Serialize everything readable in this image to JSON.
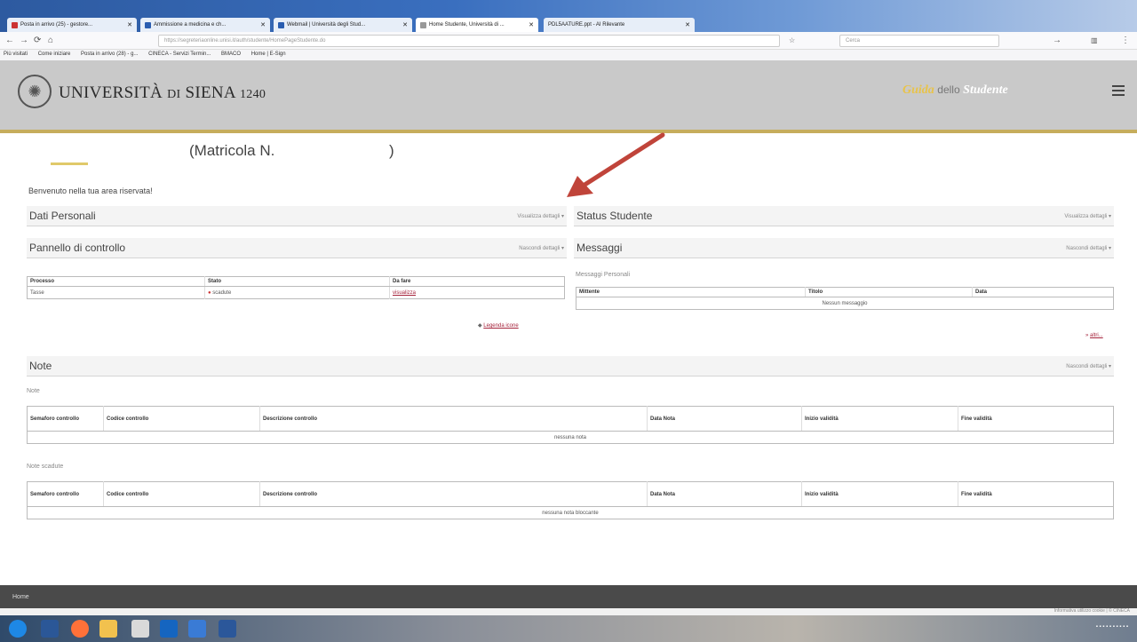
{
  "browser": {
    "tabs": [
      {
        "label": "Posta in arrivo (25) - gestore...",
        "active": false
      },
      {
        "label": "Ammissione a medicina e ch...",
        "active": false
      },
      {
        "label": "Webmail | Università degli Stud...",
        "active": false
      },
      {
        "label": "Home Studente, Università di ...",
        "active": true
      },
      {
        "label": "PDL5AATURE.ppt - AI Rilevante",
        "active": false
      }
    ],
    "url": "https://segreteriaonline.unisi.it/auth/studente/HomePageStudente.do",
    "search_placeholder": "Cerca",
    "bookmarks": [
      "Più visitati",
      "Come iniziare",
      "Posta in arrivo (28) - g...",
      "CINECA - Servizi Termin...",
      "BMACO",
      "Home | E-Sign"
    ]
  },
  "header": {
    "university_prefix": "UNIVERSITÀ",
    "university_di": "DI",
    "university_name": "SIENA",
    "university_year": "1240",
    "guide_part1": "Guida",
    "guide_part2": "dello",
    "guide_part3": "Studente"
  },
  "student": {
    "matricola_label": "(Matricola N.",
    "matricola_close": ")",
    "welcome": "Benvenuto nella tua area riservata!"
  },
  "panels": {
    "dati_personali": {
      "title": "Dati Personali",
      "details": "Visualizza dettagli"
    },
    "status_studente": {
      "title": "Status Studente",
      "details": "Visualizza dettagli"
    },
    "pannello": {
      "title": "Pannello di controllo",
      "details": "Nascondi dettagli"
    },
    "messaggi": {
      "title": "Messaggi",
      "details": "Nascondi dettagli"
    },
    "note": {
      "title": "Note",
      "details": "Nascondi dettagli"
    }
  },
  "control_table": {
    "headers": [
      "Processo",
      "Stato",
      "Da fare"
    ],
    "rows": [
      {
        "processo": "Tasse",
        "stato": "scadute",
        "da_fare": "visualizza"
      }
    ],
    "legend_link": "Legenda icone"
  },
  "messages": {
    "sublabel": "Messaggi Personali",
    "headers": [
      "Mittente",
      "Titolo",
      "Data"
    ],
    "empty": "Nessun messaggio",
    "all_link": "altri..."
  },
  "notes": {
    "note_label": "Note",
    "expired_label": "Note scadute",
    "headers": [
      "Semaforo controllo",
      "Codice controllo",
      "Descrizione controllo",
      "Data Nota",
      "Inizio validità",
      "Fine validità"
    ],
    "empty_notes": "nessuna nota",
    "empty_expired": "nessuna nota bloccante"
  },
  "footer": {
    "home": "Home",
    "credits": "Informativa utilizzo cookie | © CINECA"
  },
  "colors": {
    "accent": "#a6243c",
    "header_bg": "#c9c9c9",
    "gold": "#c6ad5c",
    "arrow": "#c0443a"
  }
}
